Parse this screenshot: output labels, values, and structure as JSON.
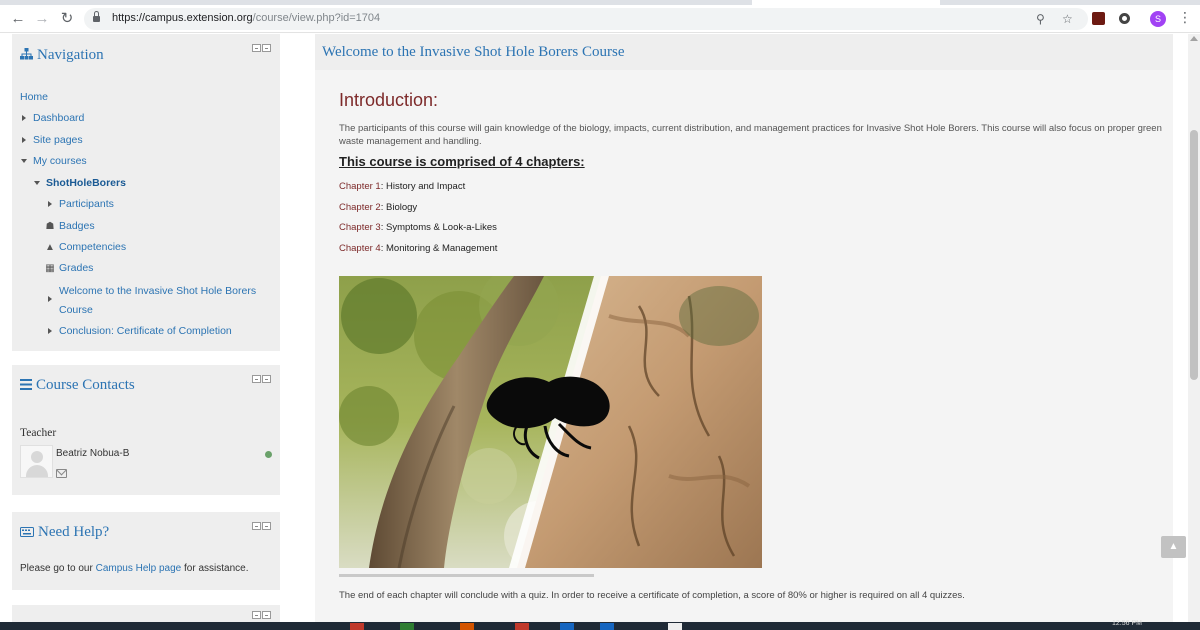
{
  "browser": {
    "url_host": "https://campus.extension.org",
    "url_path": "/course/view.php?id=1704",
    "profile_initial": "S",
    "icons": [
      "back-arrow-icon",
      "forward-arrow-icon",
      "reload-icon",
      "lock-icon",
      "zoom-icon",
      "star-icon",
      "pdf-extension-icon",
      "circle-extension-icon",
      "profile-avatar",
      "menu-dots-icon"
    ]
  },
  "sidebar": {
    "navigation": {
      "title": "Navigation",
      "items": [
        {
          "label": "Home"
        },
        {
          "label": "Dashboard"
        },
        {
          "label": "Site pages"
        },
        {
          "label": "My courses"
        },
        {
          "label": "ShotHoleBorers"
        },
        {
          "label": "Participants"
        },
        {
          "label": "Badges"
        },
        {
          "label": "Competencies"
        },
        {
          "label": "Grades"
        },
        {
          "label": "Welcome to the Invasive Shot Hole Borers"
        },
        {
          "label": "Course"
        },
        {
          "label": "Conclusion: Certificate of Completion"
        }
      ]
    },
    "contacts": {
      "title": "Course Contacts",
      "teacher_label": "Teacher",
      "teacher_name": "Beatriz Nobua-B"
    },
    "help": {
      "title": "Need Help?",
      "text_before": "Please go to our ",
      "link": "Campus Help page",
      "text_after": " for assistance."
    }
  },
  "main": {
    "course_title": "Welcome to the Invasive Shot Hole Borers Course",
    "intro_heading": "Introduction:",
    "intro_text": "The participants of this course  will gain knowledge of the biology, impacts, current distribution, and management practices for Invasive Shot Hole Borers. This course will also focus on proper green waste management and handling.",
    "chapters_heading": "This course is comprised of 4 chapters:",
    "chapters": [
      {
        "num": "Chapter 1",
        "title": ": History and Impact"
      },
      {
        "num": "Chapter 2",
        "title": ": Biology"
      },
      {
        "num": "Chapter 3",
        "title": ": Symptoms & Look-a-Likes"
      },
      {
        "num": "Chapter 4",
        "title": ": Monitoring & Management"
      }
    ],
    "outro_text": "The end of each chapter will conclude with a quiz. In order to receive a certificate of completion, a score of 80% or higher is required on all 4 quizzes."
  },
  "taskbar": {
    "clock": "12:56 PM"
  }
}
